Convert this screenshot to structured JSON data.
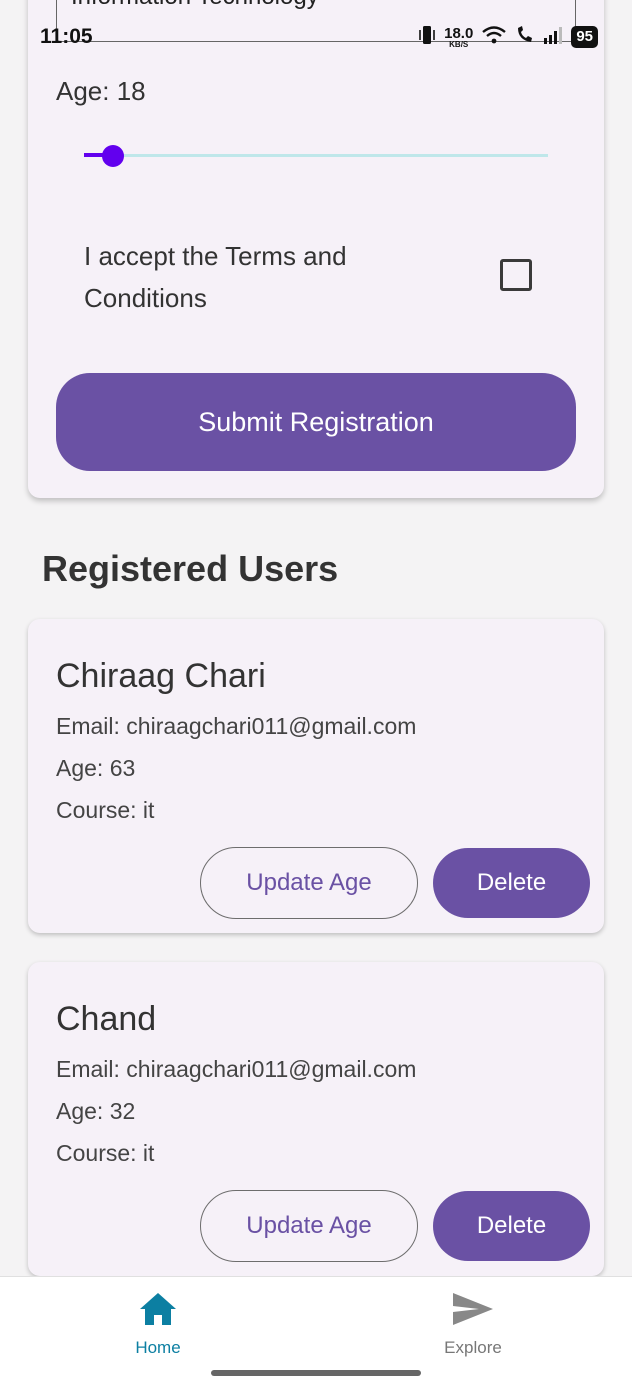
{
  "status_bar": {
    "time": "11:05",
    "net_speed": "18.0",
    "net_unit": "KB/S",
    "battery": "95"
  },
  "form": {
    "course_field_value": "Information Technology",
    "age_label": "Age: 18",
    "age_slider_fraction": 0.04,
    "terms_label": "I accept the Terms and Conditions",
    "terms_checked": false,
    "submit_label": "Submit Registration"
  },
  "users_section": {
    "title": "Registered Users",
    "users": [
      {
        "name": "Chiraag Chari",
        "email": "Email: chiraagchari011@gmail.com",
        "age": "Age: 63",
        "course": "Course: it",
        "update_label": "Update Age",
        "delete_label": "Delete"
      },
      {
        "name": "Chand",
        "email": "Email: chiraagchari011@gmail.com",
        "age": "Age: 32",
        "course": "Course: it",
        "update_label": "Update Age",
        "delete_label": "Delete"
      }
    ]
  },
  "bottom_nav": {
    "items": [
      {
        "label": "Home",
        "icon": "home-icon",
        "active": true
      },
      {
        "label": "Explore",
        "icon": "send-icon",
        "active": false
      }
    ]
  },
  "colors": {
    "primary": "#6a51a4",
    "slider": "#6200ee",
    "nav_active": "#0c7fa2"
  }
}
